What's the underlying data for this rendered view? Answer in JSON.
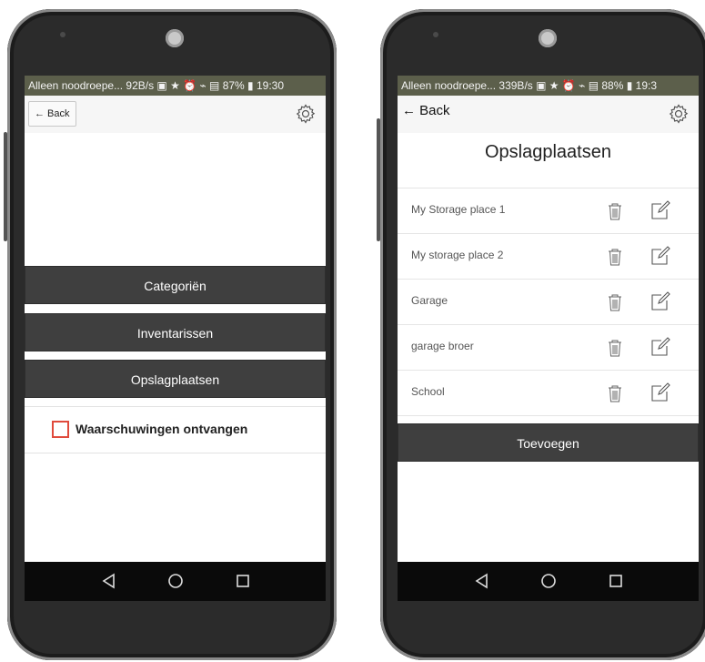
{
  "colors": {
    "accent_checkbox": "#e04a3c",
    "button_bg": "#3f3f3f",
    "status_bar": "#5c5f4b"
  },
  "left_screen": {
    "status_text": "Alleen noodroepe... 92B/s ▣ ★ ⏰ ⌁ ▤ 87% ▮ 19:30",
    "back_label": "← Back",
    "menu": [
      "Categoriën",
      "Inventarissen",
      "Opslagplaatsen"
    ],
    "warning_label": "Waarschuwingen ontvangen",
    "warning_checked": false
  },
  "right_screen": {
    "status_text": "Alleen noodroepe... 339B/s ▣ ★ ⏰ ⌁ ▤ 88% ▮ 19:3",
    "back_label": "← Back",
    "title": "Opslagplaatsen",
    "items": [
      "My Storage place 1",
      "My storage place 2",
      "Garage",
      "garage broer",
      "School"
    ],
    "add_label": "Toevoegen"
  },
  "icons": [
    "gear-icon",
    "trash-icon",
    "edit-icon",
    "nav-back-icon",
    "nav-home-icon",
    "nav-recents-icon"
  ]
}
